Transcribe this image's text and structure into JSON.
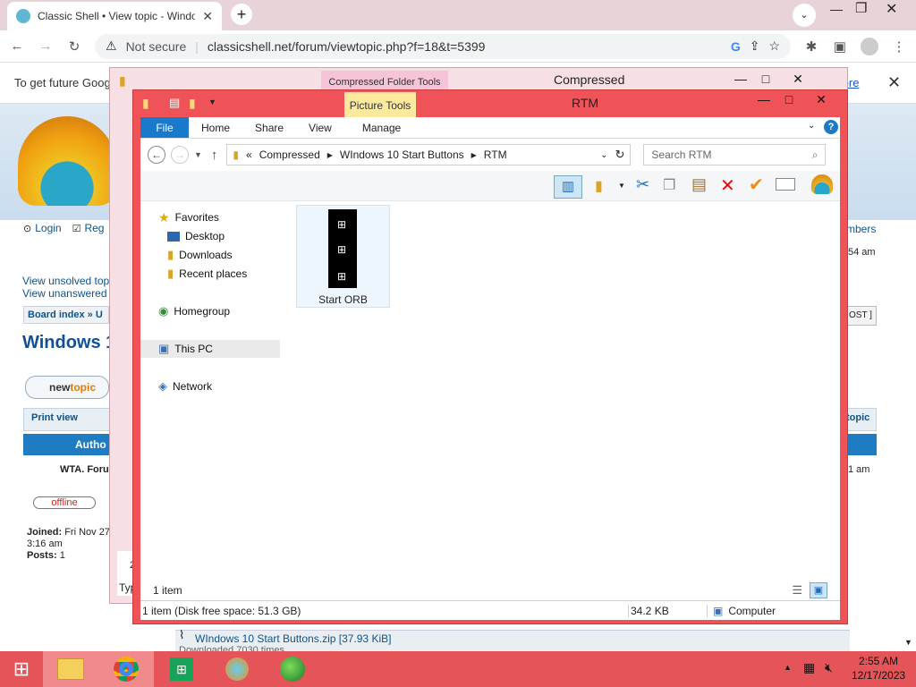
{
  "browser": {
    "tab_title": "Classic Shell • View topic - Windo",
    "not_secure": "Not secure",
    "url": "classicshell.net/forum/viewtopic.php?f=18&t=5399",
    "infobar_text": "To get future Goog",
    "infobar_link": "n more"
  },
  "forum": {
    "login": "Login",
    "register": "Reg",
    "members": "mbers",
    "time_right": "54 am",
    "view_unsolved": "View unsolved top",
    "view_unanswered": "View unanswered",
    "board_index": "Board index",
    "board_sep": "» U",
    "post_btn": "OST ]",
    "topic_title": "Windows 1",
    "new_topic_a": "new",
    "new_topic_b": "topic",
    "print_view": "Print view",
    "topic_right": "topic",
    "author": "Autho",
    "author_name": "WTA. Foru",
    "post_time": "1 am",
    "offline": "offline",
    "joined_label": "Joined:",
    "joined_value": "Fri Nov 27",
    "joined_time": "3:16 am",
    "posts_label": "Posts:",
    "posts_value": "1",
    "attachment": "WIndows 10 Start Buttons.zip [37.93 KiB]",
    "downloaded": "Downloaded 7030 times",
    "typ": "Typ",
    "two": "2"
  },
  "bg_window": {
    "context_tab": "Compressed Folder Tools",
    "title": "Compressed"
  },
  "explorer": {
    "context_tab": "Picture Tools",
    "title": "RTM",
    "tabs": {
      "file": "File",
      "home": "Home",
      "share": "Share",
      "view": "View",
      "manage": "Manage"
    },
    "breadcrumb": [
      "Compressed",
      "WIndows 10 Start Buttons",
      "RTM"
    ],
    "breadcrumb_prefix": "«",
    "search_placeholder": "Search RTM",
    "nav": {
      "favorites": "Favorites",
      "desktop": "Desktop",
      "downloads": "Downloads",
      "recent": "Recent places",
      "homegroup": "Homegroup",
      "this_pc": "This PC",
      "network": "Network"
    },
    "file_item": "Start ORB",
    "item_count": "1 item",
    "status_disk": "1 item (Disk free space: 51.3 GB)",
    "status_size": "34.2 KB",
    "status_location": "Computer"
  },
  "taskbar": {
    "time": "2:55 AM",
    "date": "12/17/2023"
  }
}
